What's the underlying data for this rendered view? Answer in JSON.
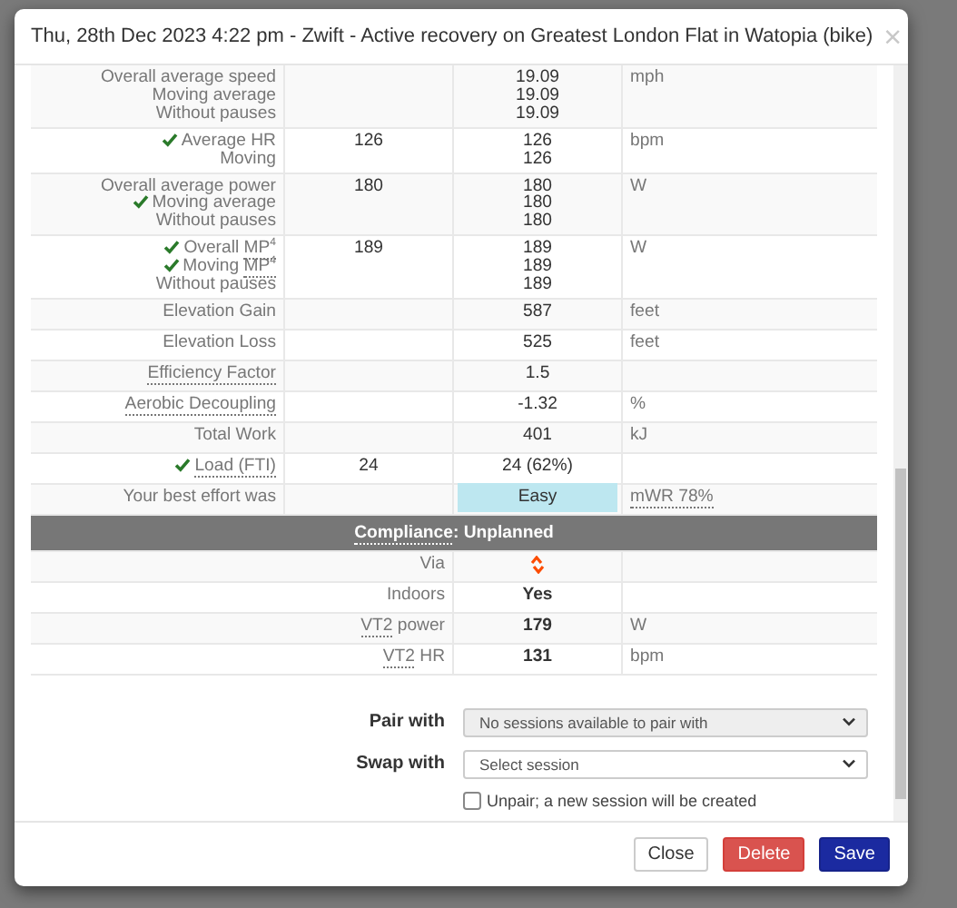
{
  "dialog": {
    "title": "Thu, 28th Dec 2023 4:22 pm - Zwift - Active recovery on Greatest London Flat in Watopia (bike)",
    "close": "×"
  },
  "rows": [
    {
      "kind": "stat",
      "labels": [
        {
          "parts": [
            {
              "text": "Overall average speed",
              "dotted": false
            }
          ],
          "check": false
        },
        {
          "parts": [
            {
              "text": "Moving average",
              "dotted": false
            }
          ],
          "check": false
        },
        {
          "parts": [
            {
              "text": "Without pauses",
              "dotted": false
            }
          ],
          "check": false
        }
      ],
      "values": [
        "19.09",
        "19.09",
        "19.09"
      ],
      "unit": "mph"
    },
    {
      "kind": "stat",
      "labels": [
        {
          "parts": [
            {
              "text": "Average HR",
              "dotted": false
            }
          ],
          "check": true
        },
        {
          "parts": [
            {
              "text": "Moving",
              "dotted": false
            }
          ],
          "check": false
        }
      ],
      "planned": "126",
      "values": [
        "126",
        "126"
      ],
      "unit": "bpm"
    },
    {
      "kind": "stat",
      "labels": [
        {
          "parts": [
            {
              "text": "Overall average power",
              "dotted": false
            }
          ],
          "check": false
        },
        {
          "parts": [
            {
              "text": "Moving average",
              "dotted": false
            }
          ],
          "check": true
        },
        {
          "parts": [
            {
              "text": "Without pauses",
              "dotted": false
            }
          ],
          "check": false
        }
      ],
      "planned": "180",
      "values": [
        "180",
        "180",
        "180"
      ],
      "unit": "W"
    },
    {
      "kind": "stat",
      "labels": [
        {
          "parts": [
            {
              "text": "Overall",
              "dotted": false
            },
            {
              "text": "MP$^{4}$",
              "dotted": true
            }
          ],
          "check": true
        },
        {
          "parts": [
            {
              "text": "Moving",
              "dotted": false
            },
            {
              "text": "MP$^{4}$",
              "dotted": true
            }
          ],
          "check": true
        },
        {
          "parts": [
            {
              "text": "Without pauses",
              "dotted": false
            }
          ],
          "check": false
        }
      ],
      "planned": "189",
      "values": [
        "189",
        "189",
        "189"
      ],
      "unit": "W"
    },
    {
      "kind": "stat",
      "labels": [
        {
          "parts": [
            {
              "text": "Elevation Gain",
              "dotted": false
            }
          ],
          "check": false
        }
      ],
      "values": [
        "587"
      ],
      "unit": "feet"
    },
    {
      "kind": "stat",
      "labels": [
        {
          "parts": [
            {
              "text": "Elevation Loss",
              "dotted": false
            }
          ],
          "check": false
        }
      ],
      "values": [
        "525"
      ],
      "unit": "feet"
    },
    {
      "kind": "stat",
      "labels": [
        {
          "parts": [
            {
              "text": "Efficiency Factor",
              "dotted": true
            }
          ],
          "check": false
        }
      ],
      "values": [
        "1.5"
      ]
    },
    {
      "kind": "stat",
      "labels": [
        {
          "parts": [
            {
              "text": "Aerobic Decoupling",
              "dotted": true
            }
          ],
          "check": false
        }
      ],
      "values": [
        "-1.32"
      ],
      "unit": "%"
    },
    {
      "kind": "stat",
      "labels": [
        {
          "parts": [
            {
              "text": "Total Work",
              "dotted": false
            }
          ],
          "check": false
        }
      ],
      "values": [
        "401"
      ],
      "unit": "kJ"
    },
    {
      "kind": "stat",
      "labels": [
        {
          "parts": [
            {
              "text": "Load (FTI)",
              "dotted": true
            }
          ],
          "check": true
        }
      ],
      "planned": "24",
      "values": [
        "24 (62%)"
      ]
    },
    {
      "kind": "effort",
      "labels": [
        {
          "parts": [
            {
              "text": "Your best effort was",
              "dotted": false
            }
          ],
          "check": false
        }
      ],
      "badge": "Easy",
      "unit": "mWR 78%"
    },
    {
      "kind": "header",
      "parts": [
        {
          "text": "Compliance",
          "dotted": true
        },
        {
          "text": ": Unplanned",
          "dotted": false,
          "attached": true
        }
      ]
    },
    {
      "kind": "via",
      "labels": [
        {
          "parts": [
            {
              "text": "Via",
              "dotted": false
            }
          ],
          "check": false
        }
      ]
    },
    {
      "kind": "setting",
      "labels": [
        {
          "parts": [
            {
              "text": "Indoors",
              "dotted": false
            }
          ],
          "check": false
        }
      ],
      "values": [
        "Yes"
      ]
    },
    {
      "kind": "setting",
      "labels": [
        {
          "parts": [
            {
              "text": "VT2",
              "dotted": true
            },
            {
              "text": "power",
              "dotted": false
            }
          ],
          "check": false
        }
      ],
      "values": [
        "179"
      ],
      "unit": "W"
    },
    {
      "kind": "setting",
      "labels": [
        {
          "parts": [
            {
              "text": "VT2",
              "dotted": true
            },
            {
              "text": "HR",
              "dotted": false
            }
          ],
          "check": false
        }
      ],
      "values": [
        "131"
      ],
      "unit": "bpm"
    }
  ],
  "form": {
    "selects": [
      {
        "label": "Pair with",
        "value": "No sessions available to pair with",
        "disabled": true
      },
      {
        "label": "Swap with",
        "value": "Select session",
        "disabled": false
      }
    ],
    "unpair": {
      "label": "Unpair; a new session will be created",
      "checked": false
    }
  },
  "buttons": [
    {
      "label": "Close",
      "kind": "default"
    },
    {
      "label": "Delete",
      "kind": "danger"
    },
    {
      "label": "Save",
      "kind": "primary"
    }
  ]
}
